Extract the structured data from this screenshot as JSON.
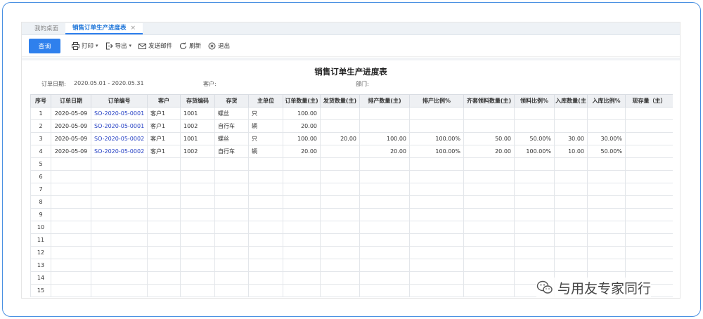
{
  "tabs": [
    {
      "label": "我的桌面",
      "active": false
    },
    {
      "label": "销售订单生产进度表",
      "active": true
    }
  ],
  "tab_close": "×",
  "toolbar": {
    "query": "查询",
    "print": "打印",
    "export": "导出",
    "send_mail": "发送邮件",
    "refresh": "刷新",
    "exit": "退出"
  },
  "report": {
    "title": "销售订单生产进度表",
    "order_date_label": "订单日期:",
    "order_date_value": "2020.05.01 - 2020.05.31",
    "customer_label": "客户:",
    "department_label": "部门:"
  },
  "table": {
    "headers": [
      "序号",
      "订单日期",
      "订单编号",
      "客户",
      "存货编码",
      "存货",
      "主单位",
      "订单数量(主)",
      "发货数量(主)",
      "排产数量(主)",
      "排产比例%",
      "齐套领料数量(主)",
      "领料比例%",
      "入库数量(主",
      "入库比例%",
      "现存量（主）"
    ],
    "rows": [
      [
        "1",
        "2020-05-09",
        "SO-2020-05-0001",
        "客户1",
        "1001",
        "螺丝",
        "只",
        "100.00",
        "",
        "",
        "",
        "",
        "",
        "",
        "",
        ""
      ],
      [
        "2",
        "2020-05-09",
        "SO-2020-05-0001",
        "客户1",
        "1002",
        "自行车",
        "辆",
        "20.00",
        "",
        "",
        "",
        "",
        "",
        "",
        "",
        ""
      ],
      [
        "3",
        "2020-05-09",
        "SO-2020-05-0002",
        "客户1",
        "1001",
        "螺丝",
        "只",
        "100.00",
        "20.00",
        "100.00",
        "100.00%",
        "50.00",
        "50.00%",
        "30.00",
        "30.00%",
        ""
      ],
      [
        "4",
        "2020-05-09",
        "SO-2020-05-0002",
        "客户1",
        "1002",
        "自行车",
        "辆",
        "20.00",
        "",
        "20.00",
        "100.00%",
        "20.00",
        "100.00%",
        "10.00",
        "50.00%",
        ""
      ],
      [
        "5",
        "",
        "",
        "",
        "",
        "",
        "",
        "",
        "",
        "",
        "",
        "",
        "",
        "",
        "",
        ""
      ],
      [
        "6",
        "",
        "",
        "",
        "",
        "",
        "",
        "",
        "",
        "",
        "",
        "",
        "",
        "",
        "",
        ""
      ],
      [
        "7",
        "",
        "",
        "",
        "",
        "",
        "",
        "",
        "",
        "",
        "",
        "",
        "",
        "",
        "",
        ""
      ],
      [
        "8",
        "",
        "",
        "",
        "",
        "",
        "",
        "",
        "",
        "",
        "",
        "",
        "",
        "",
        "",
        ""
      ],
      [
        "9",
        "",
        "",
        "",
        "",
        "",
        "",
        "",
        "",
        "",
        "",
        "",
        "",
        "",
        "",
        ""
      ],
      [
        "10",
        "",
        "",
        "",
        "",
        "",
        "",
        "",
        "",
        "",
        "",
        "",
        "",
        "",
        "",
        ""
      ],
      [
        "11",
        "",
        "",
        "",
        "",
        "",
        "",
        "",
        "",
        "",
        "",
        "",
        "",
        "",
        "",
        ""
      ],
      [
        "12",
        "",
        "",
        "",
        "",
        "",
        "",
        "",
        "",
        "",
        "",
        "",
        "",
        "",
        "",
        ""
      ],
      [
        "13",
        "",
        "",
        "",
        "",
        "",
        "",
        "",
        "",
        "",
        "",
        "",
        "",
        "",
        "",
        ""
      ],
      [
        "14",
        "",
        "",
        "",
        "",
        "",
        "",
        "",
        "",
        "",
        "",
        "",
        "",
        "",
        "",
        ""
      ],
      [
        "15",
        "",
        "",
        "",
        "",
        "",
        "",
        "",
        "",
        "",
        "",
        "",
        "",
        "",
        "",
        ""
      ]
    ]
  },
  "watermark": {
    "text": "与用友专家同行",
    "icon": "wechat-icon"
  },
  "colors": {
    "accent": "#2f80ed",
    "link": "#2540c4",
    "frame": "#4a90e2"
  }
}
